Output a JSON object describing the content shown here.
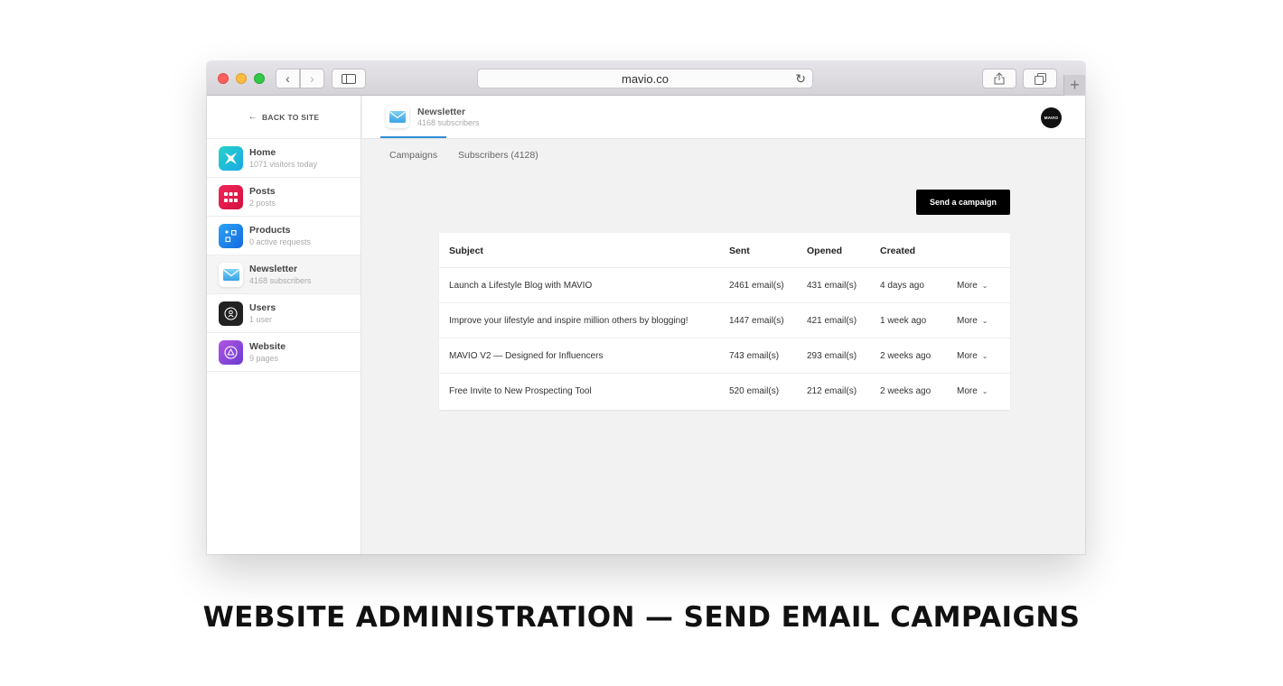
{
  "browser": {
    "url": "mavio.co",
    "back_glyph": "‹",
    "forward_glyph": "›",
    "reload_glyph": "↻",
    "newtab_glyph": "+"
  },
  "sidebar": {
    "back_link": "BACK TO SITE",
    "items": [
      {
        "name": "Home",
        "sub": "1071 visitors today",
        "icon": "home-app-icon",
        "color": "#19c2d8"
      },
      {
        "name": "Posts",
        "sub": "2 posts",
        "icon": "posts-app-icon",
        "color": "#e5174f"
      },
      {
        "name": "Products",
        "sub": "0 active requests",
        "icon": "products-app-icon",
        "color": "#1b8cf0"
      },
      {
        "name": "Newsletter",
        "sub": "4168 subscribers",
        "icon": "newsletter-app-icon",
        "color": "#ffffff"
      },
      {
        "name": "Users",
        "sub": "1 user",
        "icon": "users-app-icon",
        "color": "#222222"
      },
      {
        "name": "Website",
        "sub": "9 pages",
        "icon": "website-app-icon",
        "color": "#8b4fd8"
      }
    ]
  },
  "header": {
    "title": "Newsletter",
    "subtitle": "4168 subscribers",
    "logo_text": "MAVIO",
    "accent": "#2d8ed8"
  },
  "tabs": {
    "campaigns": "Campaigns",
    "subscribers": "Subscribers (4128)"
  },
  "actions": {
    "send_campaign": "Send a campaign"
  },
  "table": {
    "headers": {
      "subject": "Subject",
      "sent": "Sent",
      "opened": "Opened",
      "created": "Created"
    },
    "rows": [
      {
        "subject": "Launch a Lifestyle Blog with MAVIO",
        "sent": "2461 email(s)",
        "opened": "431 email(s)",
        "created": "4 days ago",
        "more": "More"
      },
      {
        "subject": "Improve your lifestyle and inspire million others by blogging!",
        "sent": "1447 email(s)",
        "opened": "421 email(s)",
        "created": "1 week ago",
        "more": "More"
      },
      {
        "subject": "MAVIO V2 — Designed for Influencers",
        "sent": "743 email(s)",
        "opened": "293 email(s)",
        "created": "2 weeks ago",
        "more": "More"
      },
      {
        "subject": "Free Invite to New Prospecting Tool",
        "sent": "520 email(s)",
        "opened": "212 email(s)",
        "created": "2 weeks ago",
        "more": "More"
      }
    ]
  },
  "caption": "WEBSITE ADMINISTRATION — SEND EMAIL CAMPAIGNS"
}
